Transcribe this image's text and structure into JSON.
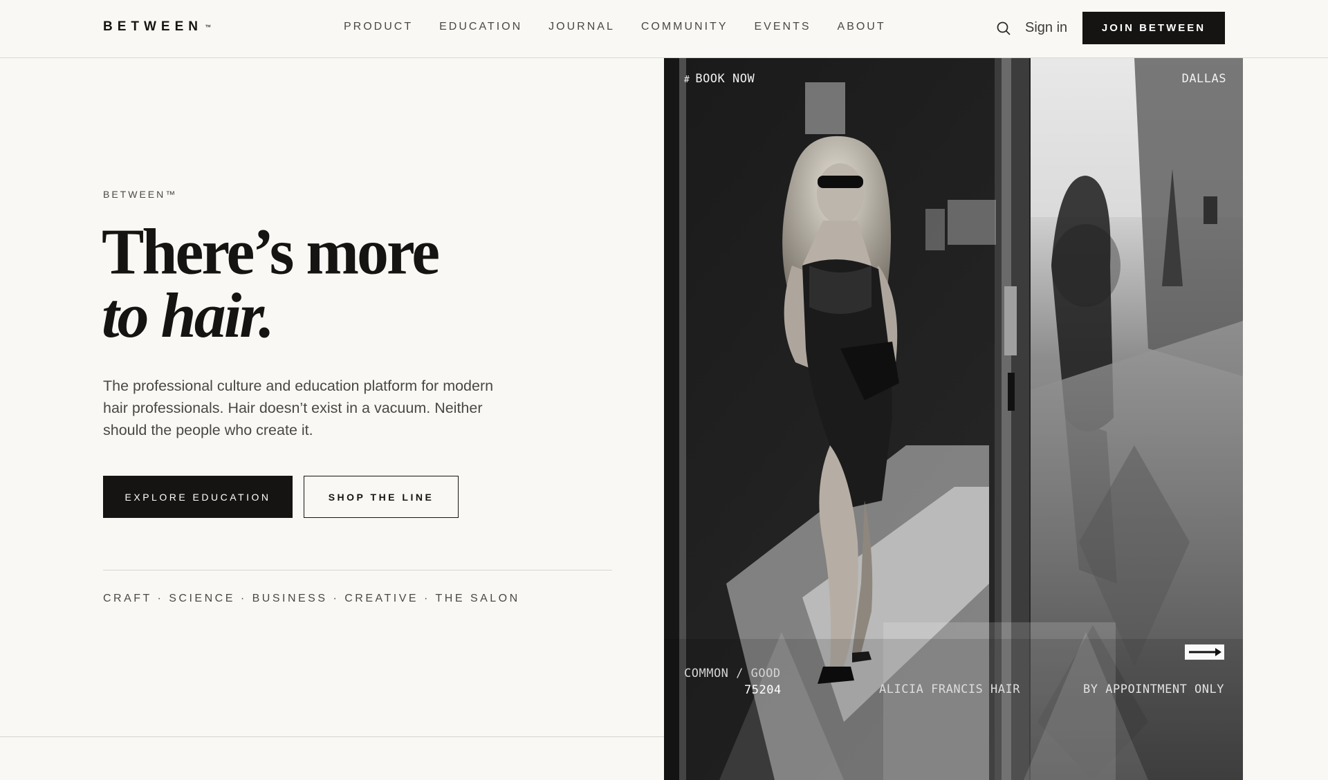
{
  "header": {
    "logo": "BETWEEN",
    "logo_tm": "™",
    "nav": [
      {
        "label": "PRODUCT"
      },
      {
        "label": "EDUCATION"
      },
      {
        "label": "JOURNAL"
      },
      {
        "label": "COMMUNITY"
      },
      {
        "label": "EVENTS"
      },
      {
        "label": "ABOUT"
      }
    ],
    "search_icon": "search-icon",
    "sign_in": "Sign in",
    "join": "JOIN BETWEEN"
  },
  "hero": {
    "eyebrow": "BETWEEN™",
    "headline_line1": "There’s more",
    "headline_line2": "to hair.",
    "lede": "The professional culture and education platform for modern hair professionals. Hair doesn’t exist in a vacuum. Neither should the people who create it.",
    "primary_cta": "EXPLORE EDUCATION",
    "secondary_cta": "SHOP THE LINE",
    "tags": "CRAFT · SCIENCE · BUSINESS · CREATIVE · THE SALON"
  },
  "photo": {
    "book_now_symbol": "#",
    "book_now": "BOOK NOW",
    "city": "DALLAS",
    "salon_name": "COMMON / GOOD",
    "zip": "75204",
    "stylist": "ALICIA FRANCIS HAIR",
    "appointment": "BY APPOINTMENT ONLY",
    "arrow_icon": "arrow-right-icon"
  },
  "colors": {
    "background": "#f9f8f4",
    "ink": "#151412",
    "muted_text": "#4a4844",
    "rule": "#d6d4ce"
  }
}
